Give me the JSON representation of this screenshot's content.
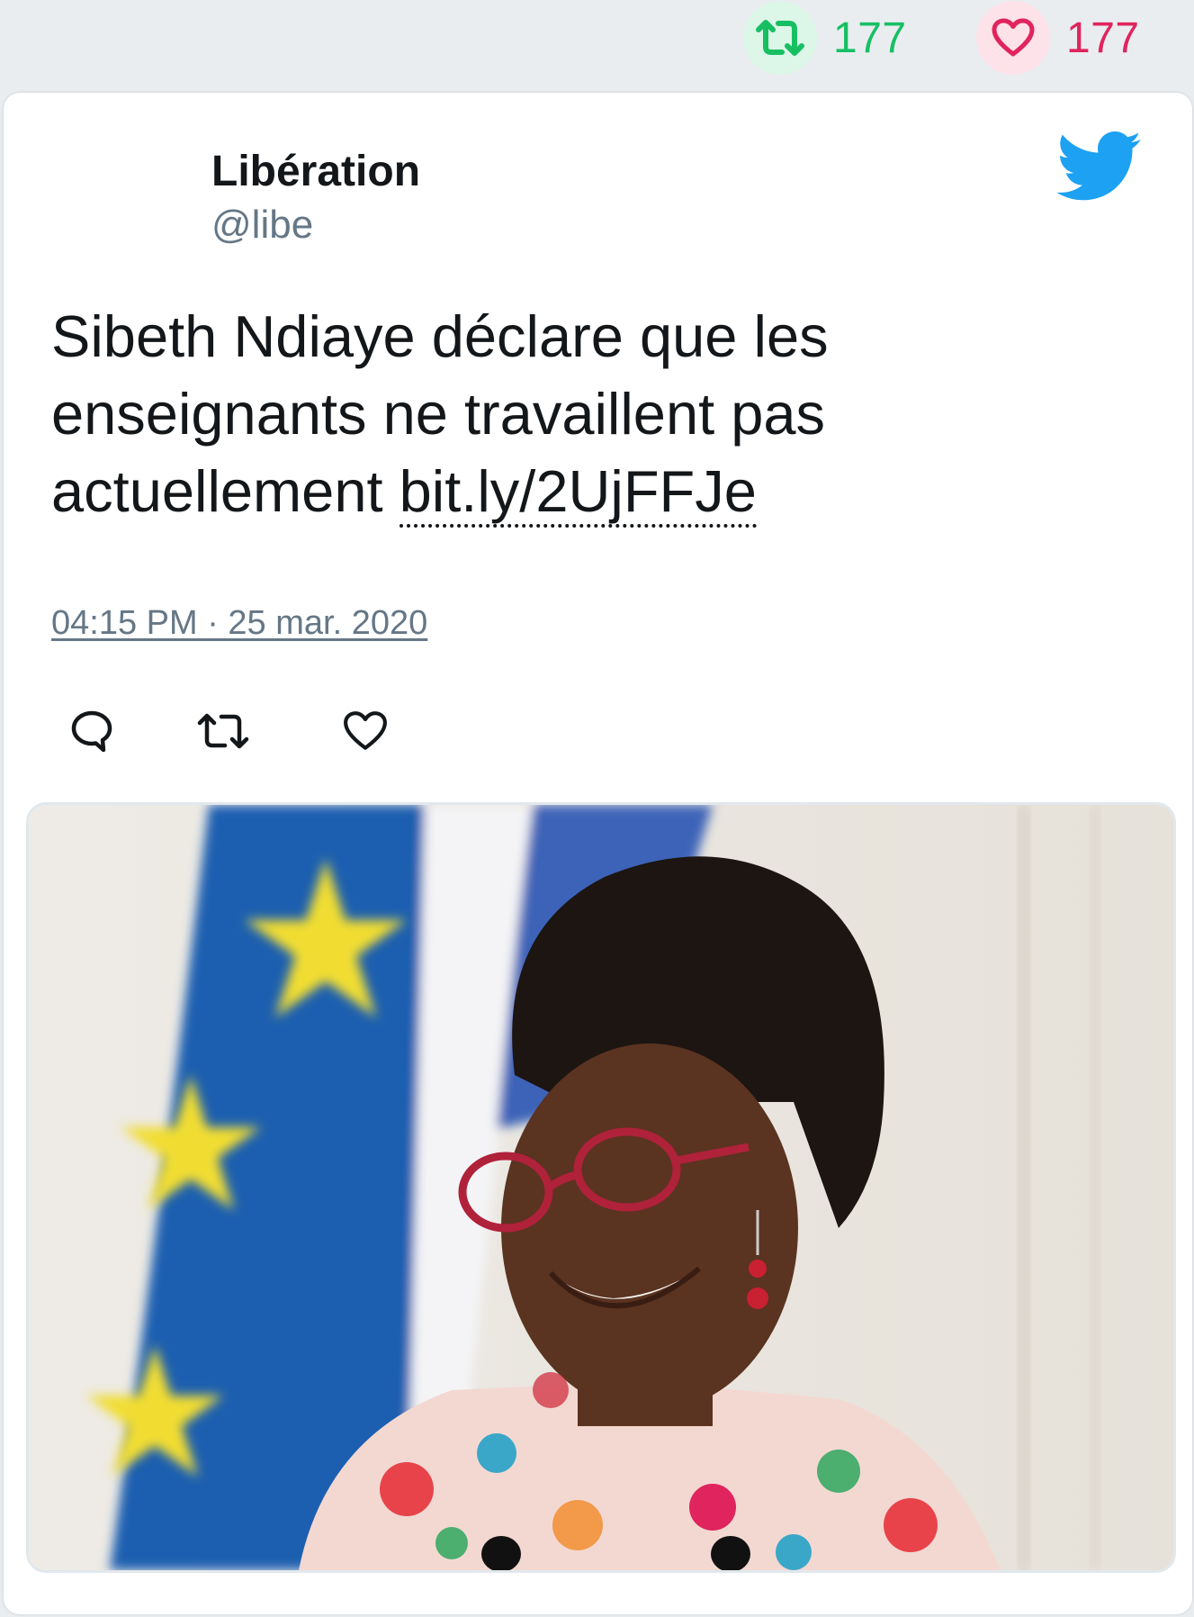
{
  "stats": {
    "retweets": "177",
    "likes": "177"
  },
  "tweet": {
    "author_name": "Libération",
    "author_handle": "@libe",
    "text_prefix": "Sibeth Ndiaye déclare que les enseignants ne travaillent pas actuellement",
    "link_text": "bit.ly/2UjFFJe",
    "timestamp": "04:15 PM · 25 mar. 2020"
  },
  "icons": {
    "brand": "twitter-bird-icon",
    "retweet": "retweet-icon",
    "like": "heart-icon",
    "reply": "reply-bubble-icon"
  },
  "colors": {
    "retweet_green": "#17bf63",
    "like_pink": "#e0245e",
    "twitter_blue": "#1da1f2",
    "muted_text": "#657786",
    "page_background": "#e9edf0"
  }
}
